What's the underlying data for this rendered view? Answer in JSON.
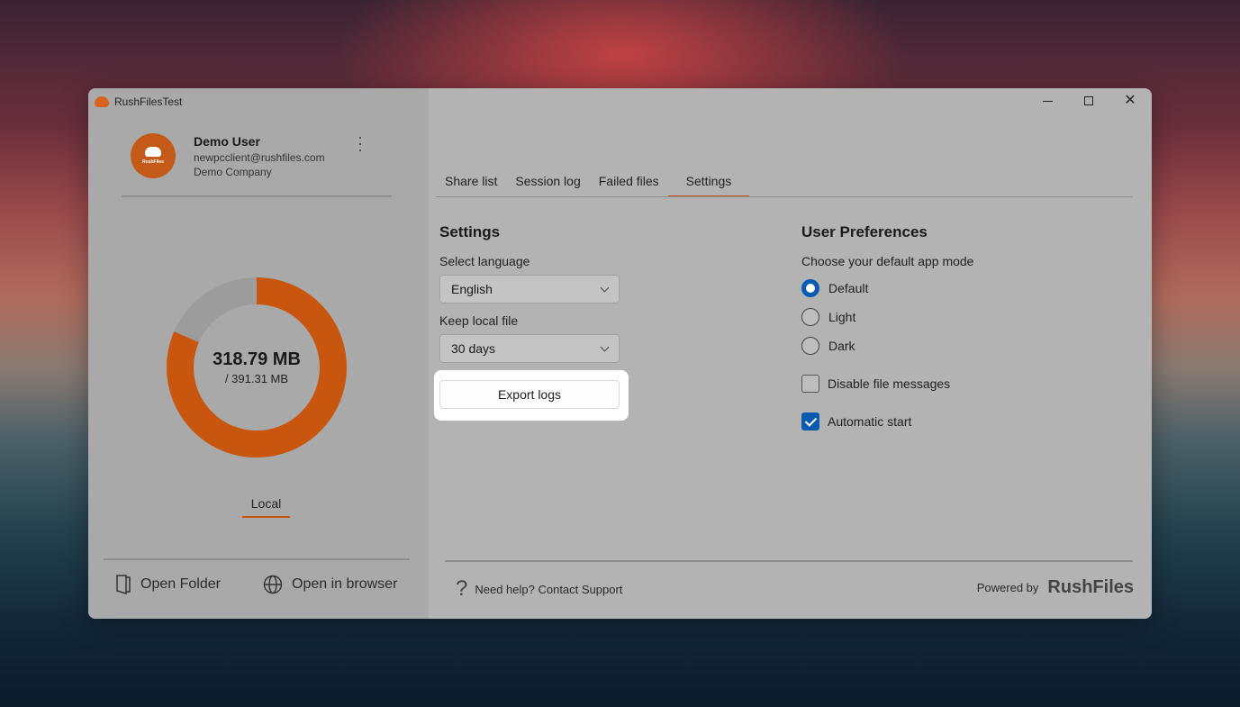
{
  "window": {
    "title": "RushFilesTest"
  },
  "user": {
    "name": "Demo User",
    "email": "newpcclient@rushfiles.com",
    "company": "Demo Company",
    "avatar_brand": "RushFiles"
  },
  "storage": {
    "used": "318.79 MB",
    "total": "/ 391.31 MB",
    "used_fraction": 0.815,
    "colors": {
      "used": "#c9560f",
      "free": "#9c9c9c"
    }
  },
  "left_tab": {
    "label": "Local"
  },
  "actions": {
    "open_folder": "Open Folder",
    "open_browser": "Open in browser"
  },
  "tabs": [
    {
      "label": "Share list"
    },
    {
      "label": "Session log"
    },
    {
      "label": "Failed files"
    },
    {
      "label": "Settings"
    }
  ],
  "settings": {
    "heading": "Settings",
    "language_label": "Select language",
    "language_value": "English",
    "keep_label": "Keep local file",
    "keep_value": "30 days",
    "export_button": "Export logs"
  },
  "preferences": {
    "heading": "User Preferences",
    "mode_label": "Choose your default app mode",
    "modes": [
      {
        "label": "Default",
        "selected": true
      },
      {
        "label": "Light",
        "selected": false
      },
      {
        "label": "Dark",
        "selected": false
      }
    ],
    "disable_messages": {
      "label": "Disable file messages",
      "checked": false
    },
    "automatic_start": {
      "label": "Automatic start",
      "checked": true
    }
  },
  "footer": {
    "help": "Need help? Contact Support",
    "powered_by": "Powered by",
    "brand": "RushFiles"
  },
  "accent_color": "#c9560f",
  "selection_color": "#0a5bb0"
}
